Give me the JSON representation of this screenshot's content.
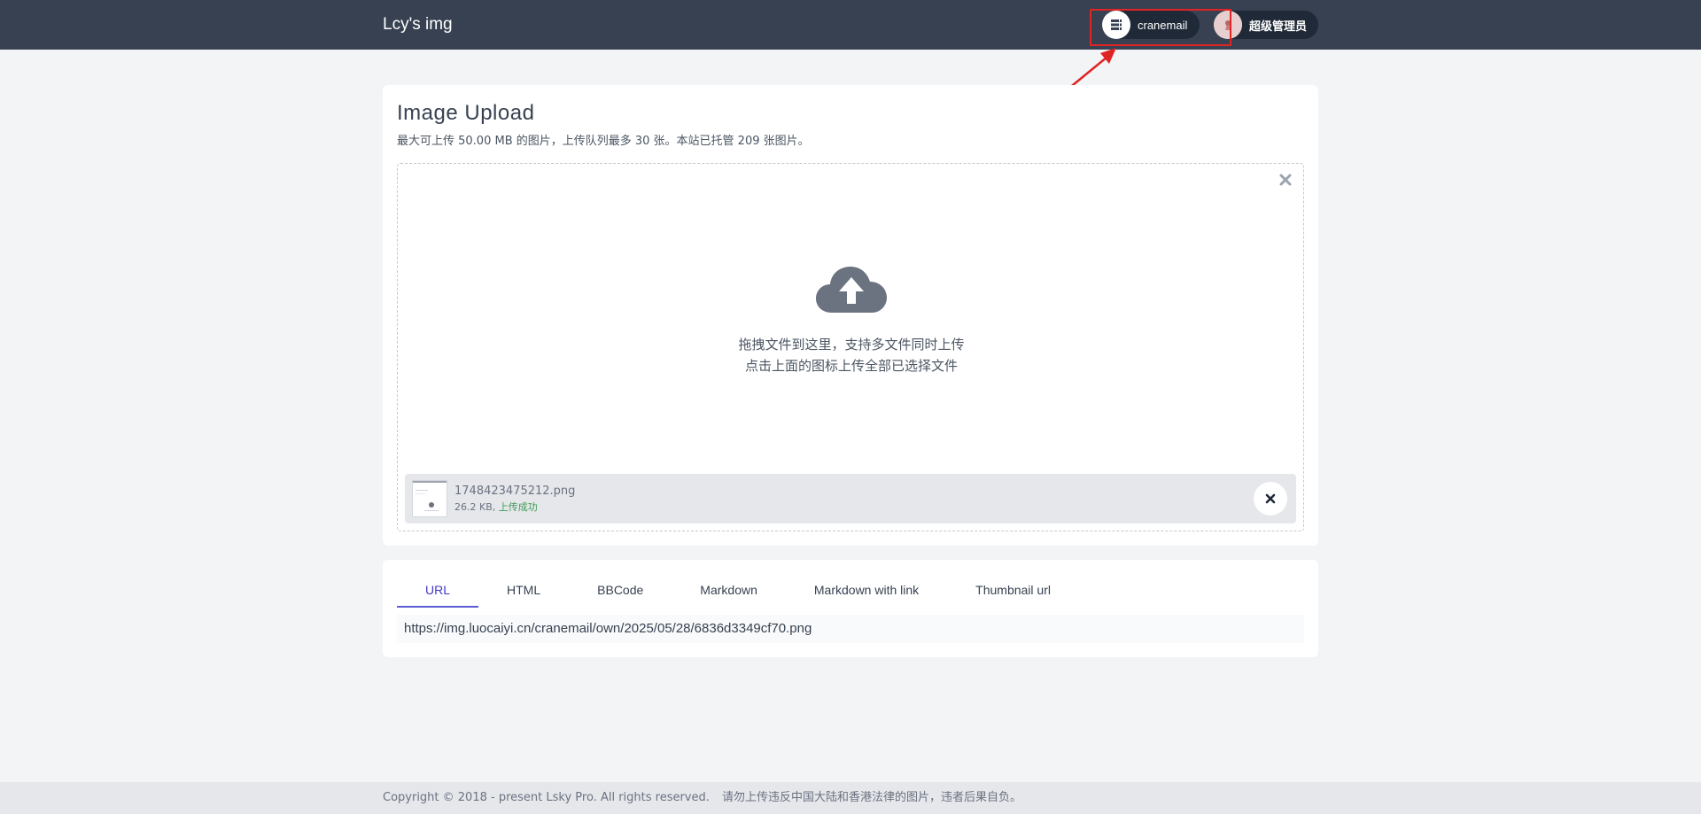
{
  "header": {
    "brand": "Lcy's img",
    "strategy_label": "cranemail",
    "user_label": "超级管理员",
    "strategy_icon": "database-icon",
    "user_icon": "avatar"
  },
  "upload": {
    "title": "Image Upload",
    "subtitle": "最大可上传 50.00 MB 的图片，上传队列最多 30 张。本站已托管 209 张图片。",
    "dropzone_line1": "拖拽文件到这里，支持多文件同时上传",
    "dropzone_line2": "点击上面的图标上传全部已选择文件",
    "file": {
      "name": "1748423475212.png",
      "size": "26.2 KB,",
      "status": "上传成功"
    }
  },
  "links": {
    "tabs": [
      {
        "label": "URL"
      },
      {
        "label": "HTML"
      },
      {
        "label": "BBCode"
      },
      {
        "label": "Markdown"
      },
      {
        "label": "Markdown with link"
      },
      {
        "label": "Thumbnail url"
      }
    ],
    "active_tab": "URL",
    "value": "https://img.luocaiyi.cn/cranemail/own/2025/05/28/6836d3349cf70.png"
  },
  "footer": {
    "copyright": "Copyright © 2018 - present Lsky Pro. All rights reserved.",
    "notice": "请勿上传违反中国大陆和香港法律的图片，违者后果自负。"
  },
  "colors": {
    "header_bg": "#374151",
    "page_bg": "#f3f4f6",
    "accent": "#5b5bd6",
    "success": "#3f9b55",
    "annotation": "#e02424"
  }
}
